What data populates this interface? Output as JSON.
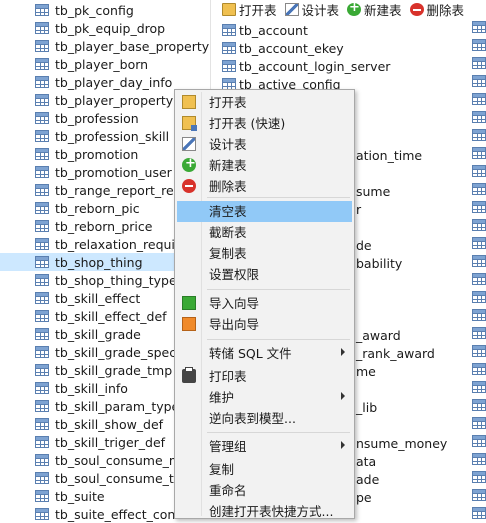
{
  "left_tables": [
    {
      "name": "tb_pk_config"
    },
    {
      "name": "tb_pk_equip_drop"
    },
    {
      "name": "tb_player_base_property"
    },
    {
      "name": "tb_player_born"
    },
    {
      "name": "tb_player_day_info"
    },
    {
      "name": "tb_player_property"
    },
    {
      "name": "tb_profession"
    },
    {
      "name": "tb_profession_skill"
    },
    {
      "name": "tb_promotion"
    },
    {
      "name": "tb_promotion_user"
    },
    {
      "name": "tb_range_report_rew"
    },
    {
      "name": "tb_reborn_pic"
    },
    {
      "name": "tb_reborn_price"
    },
    {
      "name": "tb_relaxation_require"
    },
    {
      "name": "tb_shop_thing",
      "selected": true
    },
    {
      "name": "tb_shop_thing_type"
    },
    {
      "name": "tb_skill_effect"
    },
    {
      "name": "tb_skill_effect_def"
    },
    {
      "name": "tb_skill_grade"
    },
    {
      "name": "tb_skill_grade_specia"
    },
    {
      "name": "tb_skill_grade_tmp"
    },
    {
      "name": "tb_skill_info"
    },
    {
      "name": "tb_skill_param_type"
    },
    {
      "name": "tb_skill_show_def"
    },
    {
      "name": "tb_skill_triger_def"
    },
    {
      "name": "tb_soul_consume_mo"
    },
    {
      "name": "tb_soul_consume_thi"
    },
    {
      "name": "tb_suite"
    },
    {
      "name": "tb_suite_effect_conf"
    }
  ],
  "toolbar": {
    "open": "打开表",
    "design": "设计表",
    "new": "新建表",
    "delete": "删除表"
  },
  "right_tables": [
    "tb_account",
    "tb_account_ekey",
    "tb_account_login_server",
    "tb_active_config"
  ],
  "right_fragments": [
    "ation_time",
    "sume",
    "r",
    "de",
    "bability",
    "_award",
    "_rank_award",
    "me",
    "_lib",
    "nsume_money",
    "ata",
    "ade",
    "pe"
  ],
  "context_menu": {
    "items": [
      {
        "label": "打开表",
        "icon": "open-folder-icon"
      },
      {
        "label": "打开表 (快速)",
        "icon": "open-fast-icon"
      },
      {
        "label": "设计表",
        "icon": "design-table-icon"
      },
      {
        "label": "新建表",
        "icon": "add-table-icon"
      },
      {
        "label": "删除表",
        "icon": "delete-table-icon"
      },
      {
        "label": "清空表",
        "highlighted": true
      },
      {
        "label": "截断表"
      },
      {
        "label": "复制表"
      },
      {
        "label": "设置权限"
      },
      {
        "label": "导入向导",
        "icon": "import-wizard-icon"
      },
      {
        "label": "导出向导",
        "icon": "export-wizard-icon"
      },
      {
        "label": "转储 SQL 文件",
        "submenu": true
      },
      {
        "label": "打印表",
        "icon": "printer-icon"
      },
      {
        "label": "维护",
        "submenu": true
      },
      {
        "label": "逆向表到模型..."
      },
      {
        "label": "管理组",
        "submenu": true
      },
      {
        "label": "复制"
      },
      {
        "label": "重命名"
      },
      {
        "label": "创建打开表快捷方式..."
      }
    ]
  },
  "colors": {
    "selection": "#cde8ff",
    "menu_highlight": "#91c9f7",
    "menu_background": "#f2f2f2"
  }
}
